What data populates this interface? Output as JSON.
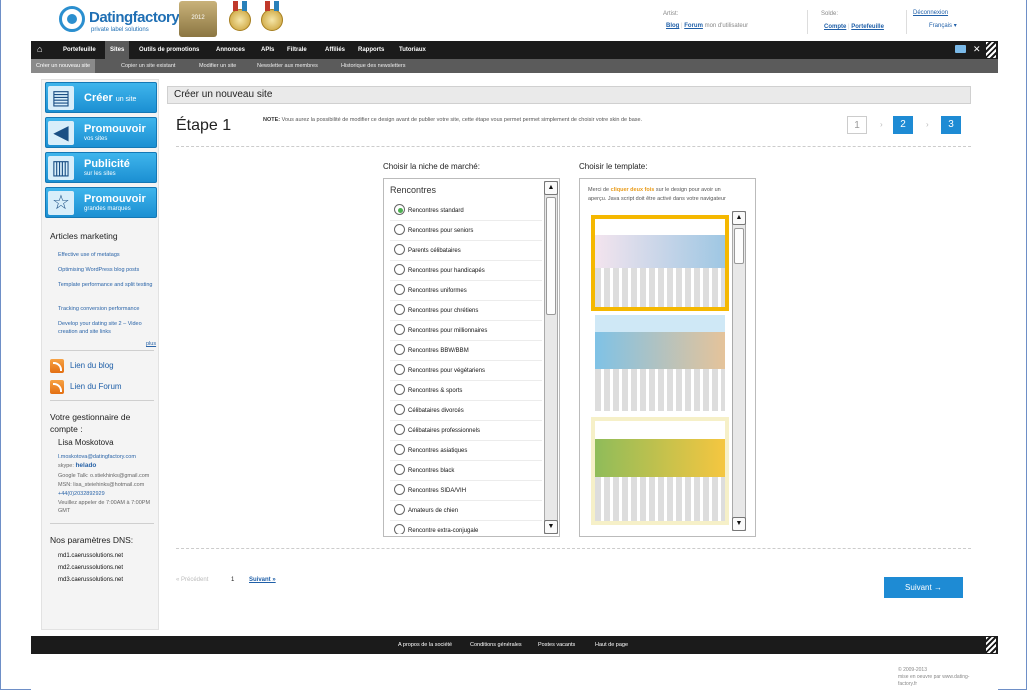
{
  "header": {
    "logo_name": "Datingfactory",
    "logo_tag": "private label solutions",
    "badge_text": "2012",
    "artist_label": "Artist:",
    "blog_link": "Blog",
    "forum_link": "Forum",
    "forum_suffix": "mon d'utilisateur",
    "solde_label": "Solde:",
    "compte_link": "Compte",
    "portefeuille_link": "Portefeuille",
    "logout_link": "Déconnexion",
    "lang_select": "Français"
  },
  "nav": {
    "items": [
      "Portefeuille",
      "Sites",
      "Outils de promotions",
      "Annonces",
      "APIs",
      "Filtrale",
      "Affiliés",
      "Rapports",
      "Tutoriaux"
    ],
    "active_index": 1
  },
  "subnav": {
    "items": [
      "Créer un nouveau site",
      "Copier un site existant",
      "Modifier un site",
      "Newsletter aux membres",
      "Historique des newsletters"
    ],
    "active_index": 0
  },
  "sidebar": {
    "buttons": [
      {
        "t1": "Créer",
        "t1b": "un site",
        "t2": ""
      },
      {
        "t1": "Promouvoir",
        "t1b": "",
        "t2": "vos sites"
      },
      {
        "t1": "Publicité",
        "t1b": "",
        "t2": "sur les sites"
      },
      {
        "t1": "Promouvoir",
        "t1b": "",
        "t2": "grandes marques"
      }
    ],
    "articles_title": "Articles marketing",
    "articles": [
      "Effective use of metatags",
      "Optimising WordPress blog posts",
      "Template performance and split testing",
      "Tracking conversion performance",
      "Develop your dating site 2 – Video creation and site links"
    ],
    "more": "plus",
    "blog_link": "Lien du blog",
    "forum_link": "Lien du Forum",
    "manager_title": "Votre gestionnaire de compte :",
    "manager_name": "Lisa Moskotova",
    "manager_email": "l.moskotova@datingfactory.com",
    "skype_label": "skype:",
    "skype_value": "helado",
    "gtalk": "Google Talk: o.stiekhinks@gmail.com",
    "msn": "MSN: lisa_steiehinks@hotmail.com",
    "phone": "+44(0)2032892929",
    "hours": "Veuillez appeler de 7:00AM à 7:00PM GMT",
    "dns_title": "Nos paramètres DNS:",
    "dns": [
      "md1.caerussolutions.net",
      "md2.caerussolutions.net",
      "md3.caerussolutions.net"
    ]
  },
  "main": {
    "title": "Créer un nouveau site",
    "step_title": "Étape 1",
    "note_label": "NOTE:",
    "note_text": "Vous aurez la possibilité de modifier ce design avant de publier votre site, cette étape vous permet permet simplement de choisir votre skin de base.",
    "steps": [
      "1",
      "2",
      "3"
    ],
    "niche_label": "Choisir la niche de marché:",
    "template_label": "Choisir le template:",
    "niche_group": "Rencontres",
    "niches": [
      "Rencontres standard",
      "Rencontres pour seniors",
      "Parents célibataires",
      "Rencontres pour handicapés",
      "Rencontres uniformes",
      "Rencontres pour chrétiens",
      "Rencontres pour millionnaires",
      "Rencontres BBW/BBM",
      "Rencontres pour végétariens",
      "Rencontres & sports",
      "Célibataires divorcés",
      "Célibataires professionnels",
      "Rencontres asiatiques",
      "Rencontres black",
      "Rencontres SIDA/VIH",
      "Amateurs de chien",
      "Rencontre extra-conjugale"
    ],
    "selected_niche": 0,
    "tpl_desc_pre": "Merci de ",
    "tpl_desc_bold": "cliquer deux fois",
    "tpl_desc_post": " sur le design pour avoir un aperçu. Java script doit être activé dans votre navigateur",
    "prev": "« Précédent",
    "page": "1",
    "next_link": "Suivant »",
    "next_button": "Suivant →"
  },
  "footer": {
    "links": [
      "A propos de la société",
      "Conditions générales",
      "Postes vacants",
      "Haut de page"
    ],
    "copyright": "© 2009-2013",
    "credit": "mise en oeuvre par www.dating-factory.fr"
  },
  "colors": {
    "accent": "#1e8bd4",
    "nav_bg": "#1b1b1b",
    "selected_tpl": "#f5b800"
  }
}
